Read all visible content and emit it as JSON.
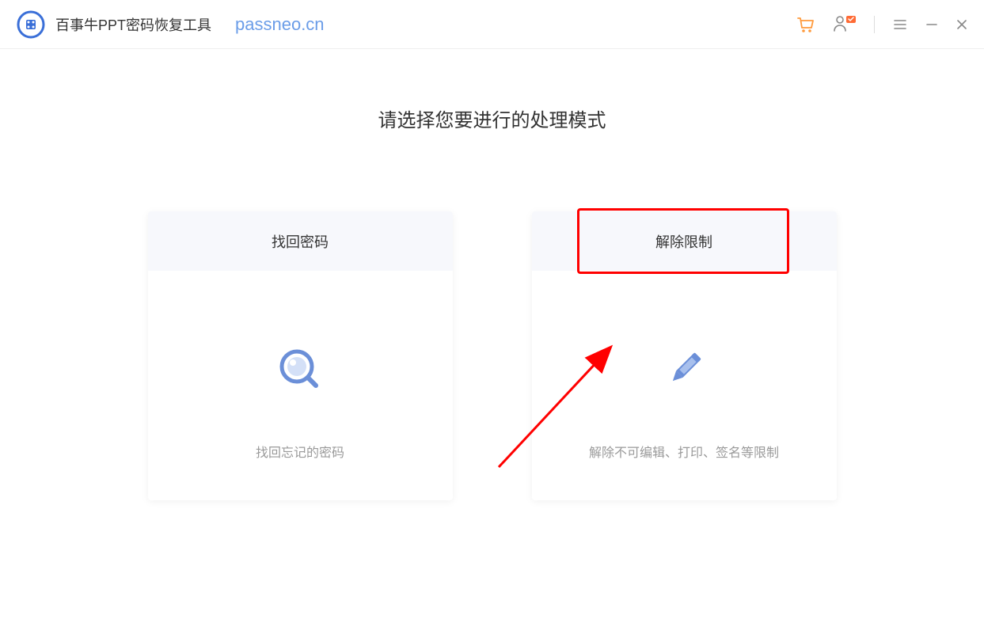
{
  "header": {
    "app_title": "百事牛PPT密码恢复工具",
    "app_url": "passneo.cn"
  },
  "main": {
    "page_title": "请选择您要进行的处理模式",
    "cards": [
      {
        "title": "找回密码",
        "desc": "找回忘记的密码"
      },
      {
        "title": "解除限制",
        "desc": "解除不可编辑、打印、签名等限制"
      }
    ]
  }
}
